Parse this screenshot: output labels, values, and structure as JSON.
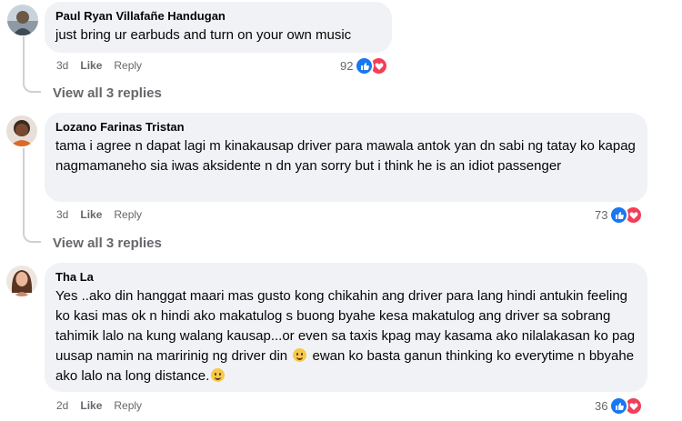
{
  "comments": [
    {
      "author": "Paul Ryan Villafañe Handugan",
      "text": "just bring ur earbuds and turn on your own music",
      "time": "3d",
      "like_label": "Like",
      "reply_label": "Reply",
      "reaction_count": "92",
      "view_replies": "View all 3 replies"
    },
    {
      "author": "Lozano Farinas Tristan",
      "text": "tama i agree n dapat lagi m kinakausap driver para mawala antok yan dn sabi ng tatay ko kapag nagmamaneho sia iwas aksidente n dn yan sorry but i think he is an idiot passenger",
      "time": "3d",
      "like_label": "Like",
      "reply_label": "Reply",
      "reaction_count": "73",
      "view_replies": "View all 3 replies"
    },
    {
      "author": "Tha La",
      "text_part1": "Yes ..ako din hanggat maari mas gusto kong chikahin ang driver para lang hindi antukin feeling ko kasi mas ok n hindi ako makatulog s buong byahe kesa makatulog ang driver sa sobrang tahimik lalo na kung walang kausap...or even sa taxis kpag may kasama ako nilalakasan ko pag uusap namin na maririnig ng driver din",
      "text_part2": " ewan ko basta ganun thinking ko everytime n bbyahe ako lalo na long distance.",
      "time": "2d",
      "like_label": "Like",
      "reply_label": "Reply",
      "reaction_count": "36"
    }
  ],
  "icons": {
    "like": "like-reaction-icon",
    "love": "love-reaction-icon",
    "emoji": "smiling-face-emoji"
  },
  "colors": {
    "bubble": "#f0f2f5",
    "meta": "#65676b",
    "like_blue": "#1877f2",
    "love_red": "#f33e58"
  }
}
